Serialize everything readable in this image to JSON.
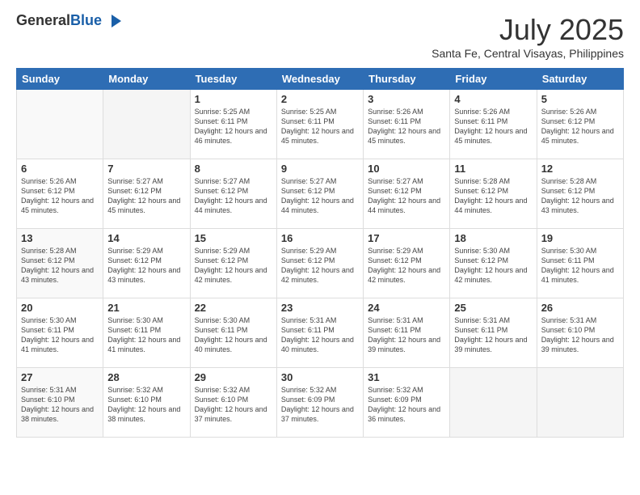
{
  "header": {
    "logo_general": "General",
    "logo_blue": "Blue",
    "month_year": "July 2025",
    "location": "Santa Fe, Central Visayas, Philippines"
  },
  "days_of_week": [
    "Sunday",
    "Monday",
    "Tuesday",
    "Wednesday",
    "Thursday",
    "Friday",
    "Saturday"
  ],
  "weeks": [
    [
      {
        "day": "",
        "info": ""
      },
      {
        "day": "",
        "info": ""
      },
      {
        "day": "1",
        "info": "Sunrise: 5:25 AM\nSunset: 6:11 PM\nDaylight: 12 hours and 46 minutes."
      },
      {
        "day": "2",
        "info": "Sunrise: 5:25 AM\nSunset: 6:11 PM\nDaylight: 12 hours and 45 minutes."
      },
      {
        "day": "3",
        "info": "Sunrise: 5:26 AM\nSunset: 6:11 PM\nDaylight: 12 hours and 45 minutes."
      },
      {
        "day": "4",
        "info": "Sunrise: 5:26 AM\nSunset: 6:11 PM\nDaylight: 12 hours and 45 minutes."
      },
      {
        "day": "5",
        "info": "Sunrise: 5:26 AM\nSunset: 6:12 PM\nDaylight: 12 hours and 45 minutes."
      }
    ],
    [
      {
        "day": "6",
        "info": "Sunrise: 5:26 AM\nSunset: 6:12 PM\nDaylight: 12 hours and 45 minutes."
      },
      {
        "day": "7",
        "info": "Sunrise: 5:27 AM\nSunset: 6:12 PM\nDaylight: 12 hours and 45 minutes."
      },
      {
        "day": "8",
        "info": "Sunrise: 5:27 AM\nSunset: 6:12 PM\nDaylight: 12 hours and 44 minutes."
      },
      {
        "day": "9",
        "info": "Sunrise: 5:27 AM\nSunset: 6:12 PM\nDaylight: 12 hours and 44 minutes."
      },
      {
        "day": "10",
        "info": "Sunrise: 5:27 AM\nSunset: 6:12 PM\nDaylight: 12 hours and 44 minutes."
      },
      {
        "day": "11",
        "info": "Sunrise: 5:28 AM\nSunset: 6:12 PM\nDaylight: 12 hours and 44 minutes."
      },
      {
        "day": "12",
        "info": "Sunrise: 5:28 AM\nSunset: 6:12 PM\nDaylight: 12 hours and 43 minutes."
      }
    ],
    [
      {
        "day": "13",
        "info": "Sunrise: 5:28 AM\nSunset: 6:12 PM\nDaylight: 12 hours and 43 minutes."
      },
      {
        "day": "14",
        "info": "Sunrise: 5:29 AM\nSunset: 6:12 PM\nDaylight: 12 hours and 43 minutes."
      },
      {
        "day": "15",
        "info": "Sunrise: 5:29 AM\nSunset: 6:12 PM\nDaylight: 12 hours and 42 minutes."
      },
      {
        "day": "16",
        "info": "Sunrise: 5:29 AM\nSunset: 6:12 PM\nDaylight: 12 hours and 42 minutes."
      },
      {
        "day": "17",
        "info": "Sunrise: 5:29 AM\nSunset: 6:12 PM\nDaylight: 12 hours and 42 minutes."
      },
      {
        "day": "18",
        "info": "Sunrise: 5:30 AM\nSunset: 6:12 PM\nDaylight: 12 hours and 42 minutes."
      },
      {
        "day": "19",
        "info": "Sunrise: 5:30 AM\nSunset: 6:11 PM\nDaylight: 12 hours and 41 minutes."
      }
    ],
    [
      {
        "day": "20",
        "info": "Sunrise: 5:30 AM\nSunset: 6:11 PM\nDaylight: 12 hours and 41 minutes."
      },
      {
        "day": "21",
        "info": "Sunrise: 5:30 AM\nSunset: 6:11 PM\nDaylight: 12 hours and 41 minutes."
      },
      {
        "day": "22",
        "info": "Sunrise: 5:30 AM\nSunset: 6:11 PM\nDaylight: 12 hours and 40 minutes."
      },
      {
        "day": "23",
        "info": "Sunrise: 5:31 AM\nSunset: 6:11 PM\nDaylight: 12 hours and 40 minutes."
      },
      {
        "day": "24",
        "info": "Sunrise: 5:31 AM\nSunset: 6:11 PM\nDaylight: 12 hours and 39 minutes."
      },
      {
        "day": "25",
        "info": "Sunrise: 5:31 AM\nSunset: 6:11 PM\nDaylight: 12 hours and 39 minutes."
      },
      {
        "day": "26",
        "info": "Sunrise: 5:31 AM\nSunset: 6:10 PM\nDaylight: 12 hours and 39 minutes."
      }
    ],
    [
      {
        "day": "27",
        "info": "Sunrise: 5:31 AM\nSunset: 6:10 PM\nDaylight: 12 hours and 38 minutes."
      },
      {
        "day": "28",
        "info": "Sunrise: 5:32 AM\nSunset: 6:10 PM\nDaylight: 12 hours and 38 minutes."
      },
      {
        "day": "29",
        "info": "Sunrise: 5:32 AM\nSunset: 6:10 PM\nDaylight: 12 hours and 37 minutes."
      },
      {
        "day": "30",
        "info": "Sunrise: 5:32 AM\nSunset: 6:09 PM\nDaylight: 12 hours and 37 minutes."
      },
      {
        "day": "31",
        "info": "Sunrise: 5:32 AM\nSunset: 6:09 PM\nDaylight: 12 hours and 36 minutes."
      },
      {
        "day": "",
        "info": ""
      },
      {
        "day": "",
        "info": ""
      }
    ]
  ]
}
